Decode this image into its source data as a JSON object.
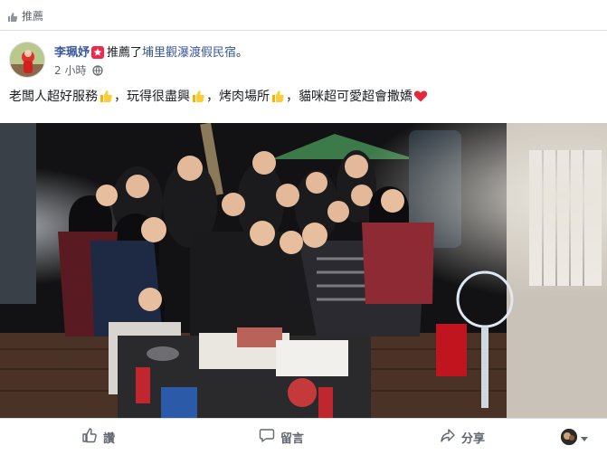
{
  "section": {
    "title": "推薦",
    "icon": "thumbs-up-icon"
  },
  "post": {
    "author": "李珮妤",
    "action": "推薦了",
    "page": "埔里觀瀑渡假民宿",
    "punctuation": "。",
    "time": "2 小時",
    "privacy_icon": "globe-icon",
    "text_segments": [
      "老闆人超好服務",
      "，玩得很盡興",
      "，烤肉場所",
      "，貓咪超可愛超會撒嬌"
    ],
    "emojis": [
      "thumbs-up",
      "thumbs-up",
      "thumbs-up",
      "red-heart"
    ]
  },
  "actions": {
    "like": "讚",
    "comment": "留言",
    "share": "分享"
  },
  "colors": {
    "link": "#385898",
    "muted": "#606770",
    "divider": "#dddfe2",
    "like_icon": "#606770"
  }
}
